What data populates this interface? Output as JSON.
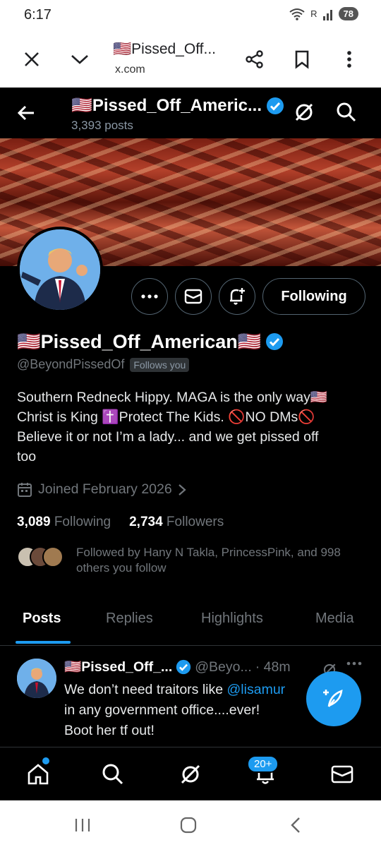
{
  "status_bar": {
    "time": "6:17",
    "signal_text": "R",
    "battery": "78"
  },
  "browser": {
    "title": "🇺🇸Pissed_Off...",
    "url": "x.com"
  },
  "header": {
    "name": "🇺🇸Pissed_Off_Americ...",
    "post_count": "3,393 posts"
  },
  "profile": {
    "display_name": "🇺🇸Pissed_Off_American🇺🇸",
    "handle": "@BeyondPissedOf",
    "follows_you": "Follows you",
    "following_button": "Following",
    "bio_lines": [
      "Southern Redneck Hippy. MAGA is the only way🇺🇸",
      "Christ is King ✝️Protect The Kids. 🚫NO DMs🚫",
      "Believe it or not I’m a lady... and we get pissed off",
      "too"
    ],
    "joined": "Joined February 2026",
    "following_count": "3,089",
    "following_label": "Following",
    "followers_count": "2,734",
    "followers_label": "Followers",
    "followed_by": "Followed by Hany N Takla, PrincessPink, and 998 others you follow"
  },
  "tabs": [
    "Posts",
    "Replies",
    "Highlights",
    "Media"
  ],
  "post": {
    "name": "🇺🇸Pissed_Off_...",
    "handle": "@Beyo...",
    "time": "· 48m",
    "text_before_mention": "We don’t need traitors like ",
    "mention": "@lisamur",
    "line2": "in any government office....ever!",
    "line3": "Boot her tf out!"
  },
  "bottom_nav": {
    "notifications_badge": "20+"
  },
  "colors": {
    "accent": "#1d9bf0",
    "background": "#000000",
    "muted_text": "#71767b"
  }
}
